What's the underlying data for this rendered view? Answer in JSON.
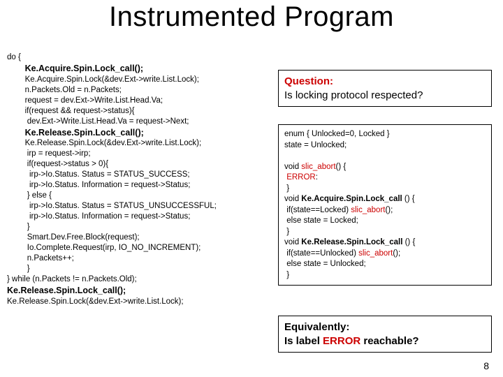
{
  "title": "Instrumented Program",
  "code": {
    "l01": "do {",
    "l02": "Ke.Acquire.Spin.Lock_call();",
    "l03": "Ke.Acquire.Spin.Lock(&dev.Ext->write.List.Lock);",
    "l04": "n.Packets.Old = n.Packets;",
    "l05": "request = dev.Ext->Write.List.Head.Va;",
    "l06": "if(request && request->status){",
    "l07": " dev.Ext->Write.List.Head.Va = request->Next;",
    "l08": "Ke.Release.Spin.Lock_call();",
    "l09": "Ke.Release.Spin.Lock(&dev.Ext->write.List.Lock);",
    "l10": " irp = request->irp;",
    "l11": " if(request->status > 0){",
    "l12": "  irp->Io.Status. Status = STATUS_SUCCESS;",
    "l13": "  irp->Io.Status. Information = request->Status;",
    "l14": " } else {",
    "l15": "  irp->Io.Status. Status = STATUS_UNSUCCESSFUL;",
    "l16": "  irp->Io.Status. Information = request->Status;",
    "l17": " }",
    "l18": " Smart.Dev.Free.Block(request);",
    "l19": " Io.Complete.Request(irp, IO_NO_INCREMENT);",
    "l20": " n.Packets++;",
    "l21": " }",
    "l22": "} while (n.Packets != n.Packets.Old);",
    "l23": "Ke.Release.Spin.Lock_call();",
    "l24": "Ke.Release.Spin.Lock(&dev.Ext->write.List.Lock);"
  },
  "question": {
    "label": "Question:",
    "text": "Is locking protocol respected?"
  },
  "aux": {
    "l01": "enum { Unlocked=0, Locked }",
    "l02": "state = Unlocked;",
    "l03": "",
    "l04a": "void ",
    "l04b": "slic_abort",
    "l04c": "() {",
    "l05a": " ",
    "l05b": "ERROR",
    "l05c": ":",
    "l06": " }",
    "l07a": "void ",
    "l07b": "Ke.Acquire.Spin.Lock_call",
    "l07c": " () {",
    "l08a": " if(state==Locked) ",
    "l08b": "slic_abort",
    "l08c": "();",
    "l09": " else state = Locked;",
    "l10": " }",
    "l11a": "void ",
    "l11b": "Ke.Release.Spin.Lock_call",
    "l11c": " () {",
    "l12a": " if(state==Unlocked) ",
    "l12b": "slic_abort",
    "l12c": "();",
    "l13": " else state = Unlocked;",
    "l14": " }"
  },
  "equiv": {
    "label": "Equivalently:",
    "t1": "Is label ",
    "t2": "ERROR",
    "t3": " reachable?"
  },
  "pageNumber": "8"
}
